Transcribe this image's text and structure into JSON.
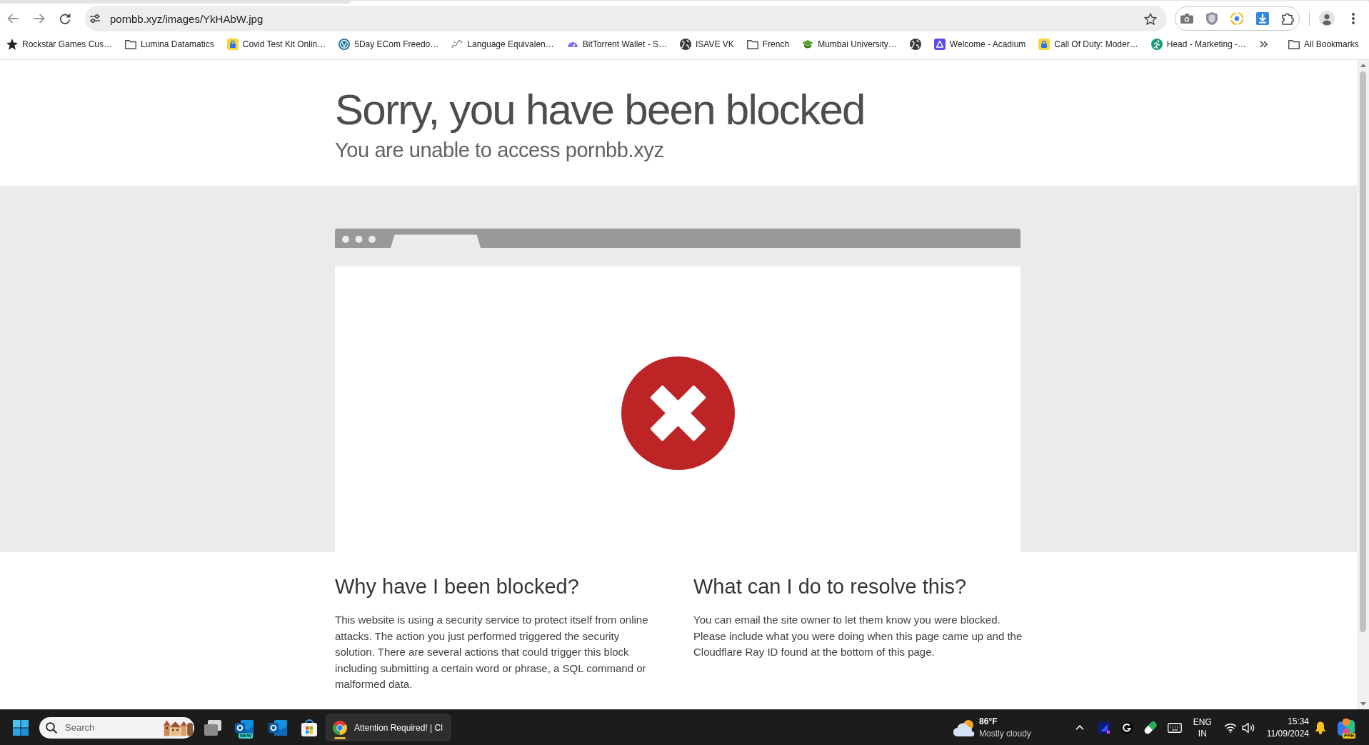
{
  "browser": {
    "url": "pornbb.xyz/images/YkHAbW.jpg",
    "bookmarks": [
      {
        "kind": "site",
        "label": "Rockstar Games Cus…"
      },
      {
        "kind": "folder",
        "label": "Lumina Datamatics"
      },
      {
        "kind": "site",
        "label": "Covid Test Kit Onlin…"
      },
      {
        "kind": "site",
        "label": "5Day ECom Freedo…"
      },
      {
        "kind": "site",
        "label": "Language Equivalen…"
      },
      {
        "kind": "site",
        "label": "BitTorrent Wallet - S…"
      },
      {
        "kind": "site",
        "label": "ISAVE VK"
      },
      {
        "kind": "folder",
        "label": "French"
      },
      {
        "kind": "site",
        "label": "Mumbai University…"
      },
      {
        "kind": "site"
      },
      {
        "kind": "site",
        "label": "Welcome - Acadium"
      },
      {
        "kind": "site",
        "label": "Call Of Duty: Moder…"
      },
      {
        "kind": "site",
        "label": "Head - Marketing -…"
      }
    ],
    "all_bookmarks": "All Bookmarks"
  },
  "page": {
    "title": "Sorry, you have been blocked",
    "subtitle": "You are unable to access pornbb.xyz",
    "sections": [
      {
        "heading": "Why have I been blocked?",
        "text": "This website is using a security service to protect itself from online attacks. The action you just performed triggered the security solution. There are several actions that could trigger this block including submitting a certain word or phrase, a SQL command or malformed data."
      },
      {
        "heading": "What can I do to resolve this?",
        "text": "You can email the site owner to let them know you were blocked. Please include what you were doing when this page came up and the Cloudflare Ray ID found at the bottom of this page."
      }
    ]
  },
  "taskbar": {
    "search": {
      "placeholder": "Search"
    },
    "apps": [
      {
        "kind": "taskview"
      },
      {
        "kind": "mail",
        "badge": "NEW"
      },
      {
        "kind": "mail"
      },
      {
        "kind": "store"
      }
    ],
    "windows": [
      {
        "title": "Attention Required! | Cl",
        "selected": true
      }
    ],
    "weather": {
      "temperature": "86°F",
      "condition": "Mostly cloudy"
    },
    "input": {
      "language": "ENG",
      "region": "IN"
    },
    "clock": {
      "time": "15:34",
      "date": "11/09/2024"
    },
    "assistant": {
      "badge": "PRE"
    }
  }
}
